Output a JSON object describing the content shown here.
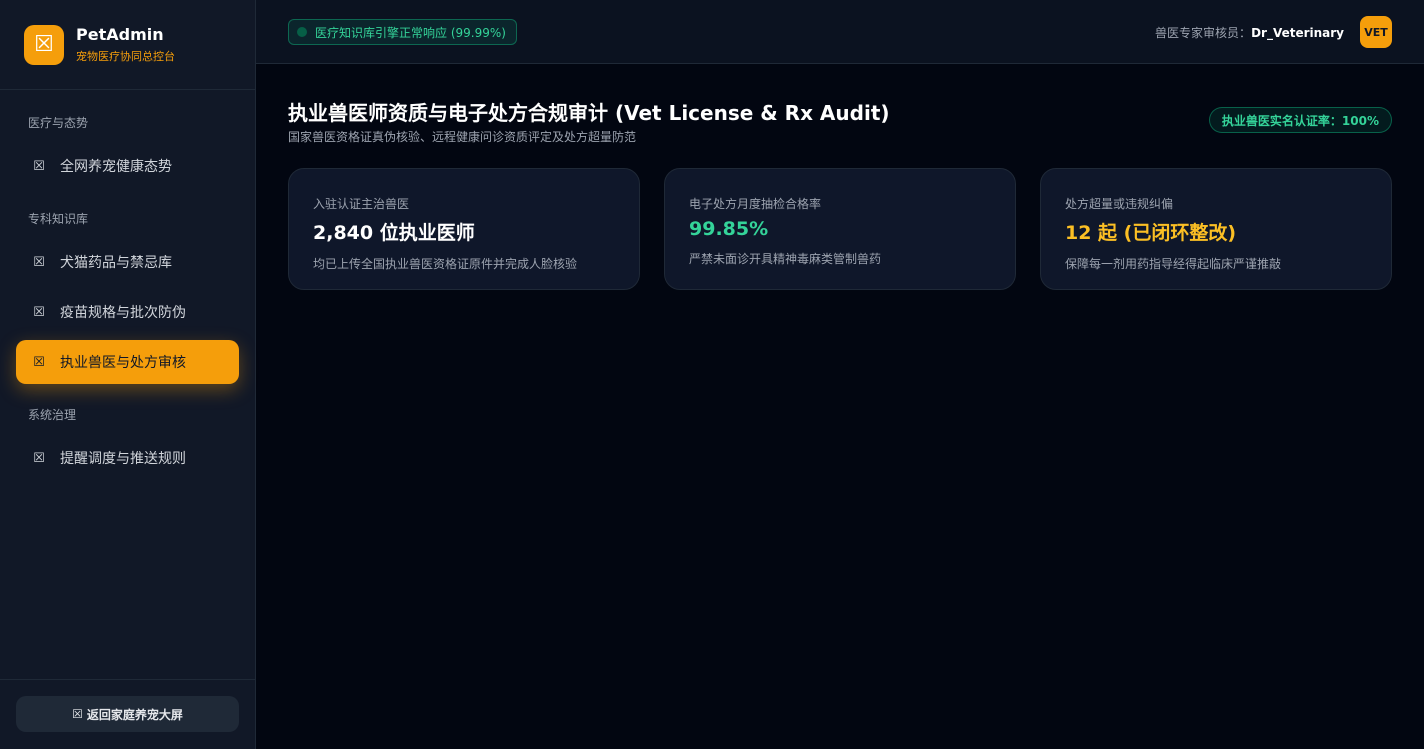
{
  "brand": {
    "name": "PetAdmin",
    "subtitle": "宠物医疗协同总控台",
    "logo_icon": "image-placeholder-icon"
  },
  "sidebar": {
    "groups": [
      {
        "title": "医疗与态势",
        "items": [
          {
            "label": "全网养宠健康态势",
            "icon": "image-placeholder-icon"
          }
        ]
      },
      {
        "title": "专科知识库",
        "items": [
          {
            "label": "犬猫药品与禁忌库",
            "icon": "image-placeholder-icon"
          },
          {
            "label": "疫苗规格与批次防伪",
            "icon": "image-placeholder-icon"
          },
          {
            "label": "执业兽医与处方审核",
            "icon": "image-placeholder-icon",
            "active": true
          }
        ]
      },
      {
        "title": "系统治理",
        "items": [
          {
            "label": "提醒调度与推送规则",
            "icon": "image-placeholder-icon"
          }
        ]
      }
    ],
    "footer_button": "返回家庭养宠大屏"
  },
  "header": {
    "status_text": "医疗知识库引擎正常响应 (99.99%)",
    "reviewer_label": "兽医专家审核员：",
    "reviewer_name": "Dr_Veterinary",
    "avatar_text": "VET"
  },
  "main": {
    "title": "执业兽医师资质与电子处方合规审计 (Vet License & Rx Audit)",
    "subtitle": "国家兽医资格证真伪核验、远程健康问诊资质评定及处方超量防范",
    "rate_badge": "执业兽医实名认证率：100%",
    "cards": [
      {
        "label": "入驻认证主治兽医",
        "value": "2,840 位执业医师",
        "desc": "均已上传全国执业兽医资格证原件并完成人脸核验",
        "color": "#ffffff"
      },
      {
        "label": "电子处方月度抽检合格率",
        "value": "99.85%",
        "desc": "严禁未面诊开具精神毒麻类管制兽药",
        "color": "#34d399"
      },
      {
        "label": "处方超量或违规纠偏",
        "value": "12 起 (已闭环整改)",
        "desc": "保障每一剂用药指导经得起临床严谨推敲",
        "color": "#fbbf24"
      }
    ]
  },
  "colors": {
    "accent": "#f59e0b",
    "success": "#34d399",
    "background": "#020611",
    "sidebar": "#111827"
  }
}
